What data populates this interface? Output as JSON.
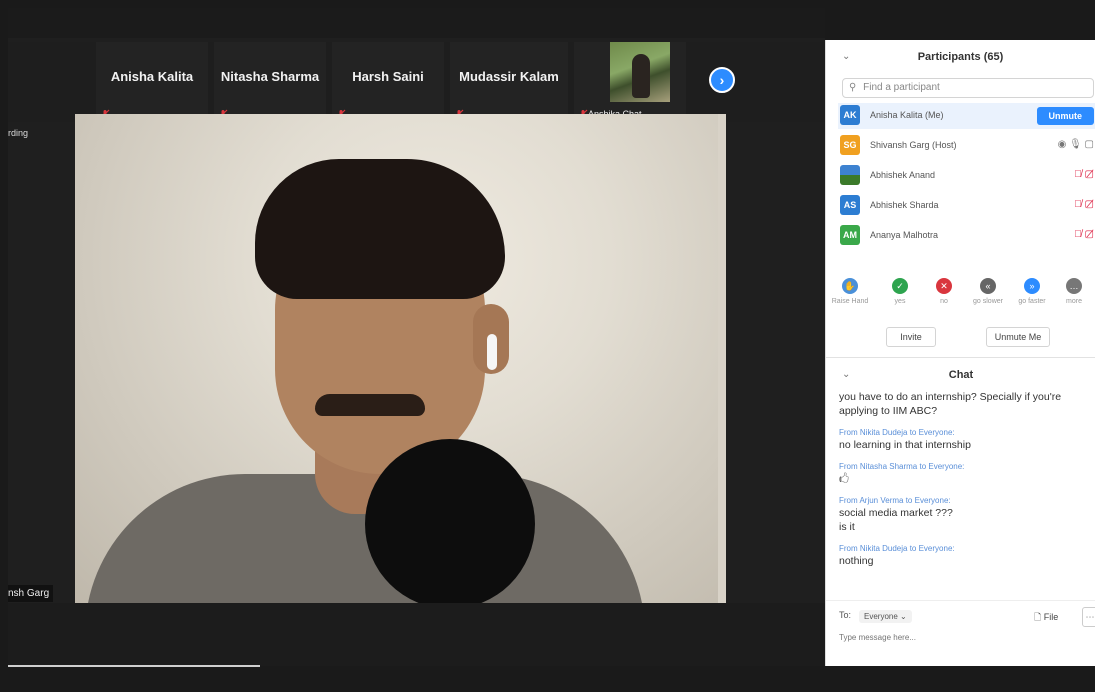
{
  "gallery": {
    "tiles": [
      {
        "name": "Anisha Kalita"
      },
      {
        "name": "Nitasha Sharma"
      },
      {
        "name": "Harsh Saini"
      },
      {
        "name": "Mudassir Kalam"
      },
      {
        "name": "Anshika Chat..."
      }
    ]
  },
  "meeting": {
    "recording_label": "rding",
    "speaker_name": "nsh Garg"
  },
  "participants": {
    "title": "Participants (65)",
    "search_placeholder": "Find a participant",
    "list": [
      {
        "initials": "AK",
        "name": "Anisha Kalita (Me)",
        "color": "#2d7dd2",
        "action": "Unmute"
      },
      {
        "initials": "SG",
        "name": "Shivansh Garg (Host)",
        "color": "#f0a020"
      },
      {
        "initials": "",
        "name": "Abhishek Anand",
        "color": "#3b7a2a"
      },
      {
        "initials": "AS",
        "name": "Abhishek Sharda",
        "color": "#2d7dd2"
      },
      {
        "initials": "AM",
        "name": "Ananya Malhotra",
        "color": "#3aa84a"
      }
    ],
    "reactions": [
      {
        "label": "Raise Hand",
        "color": "#4a90d9",
        "glyph": "✋"
      },
      {
        "label": "yes",
        "color": "#2ea44f",
        "glyph": "✓"
      },
      {
        "label": "no",
        "color": "#d9363e",
        "glyph": "✕"
      },
      {
        "label": "go slower",
        "color": "#666666",
        "glyph": "«"
      },
      {
        "label": "go faster",
        "color": "#2d8cff",
        "glyph": "»"
      },
      {
        "label": "more",
        "color": "#777777",
        "glyph": "…"
      }
    ],
    "invite_label": "Invite",
    "unmute_me_label": "Unmute Me"
  },
  "chat": {
    "title": "Chat",
    "messages": [
      {
        "from": "",
        "to": "",
        "text": "you have to do an internship? Specially if you're applying to IIM ABC?"
      },
      {
        "from": "Nikita Dudeja",
        "to": "Everyone",
        "text": "no learning in that internship"
      },
      {
        "from": "Nitasha Sharma",
        "to": "Everyone",
        "text": "🖒"
      },
      {
        "from": "Arjun Verma",
        "to": "Everyone",
        "text": "social media market ???",
        "text2": "is it"
      },
      {
        "from": "Nikita Dudeja",
        "to": "Everyone",
        "text": "nothing"
      }
    ],
    "to_label": "To:",
    "to_value": "Everyone",
    "file_label": "File",
    "input_placeholder": "Type message here..."
  }
}
